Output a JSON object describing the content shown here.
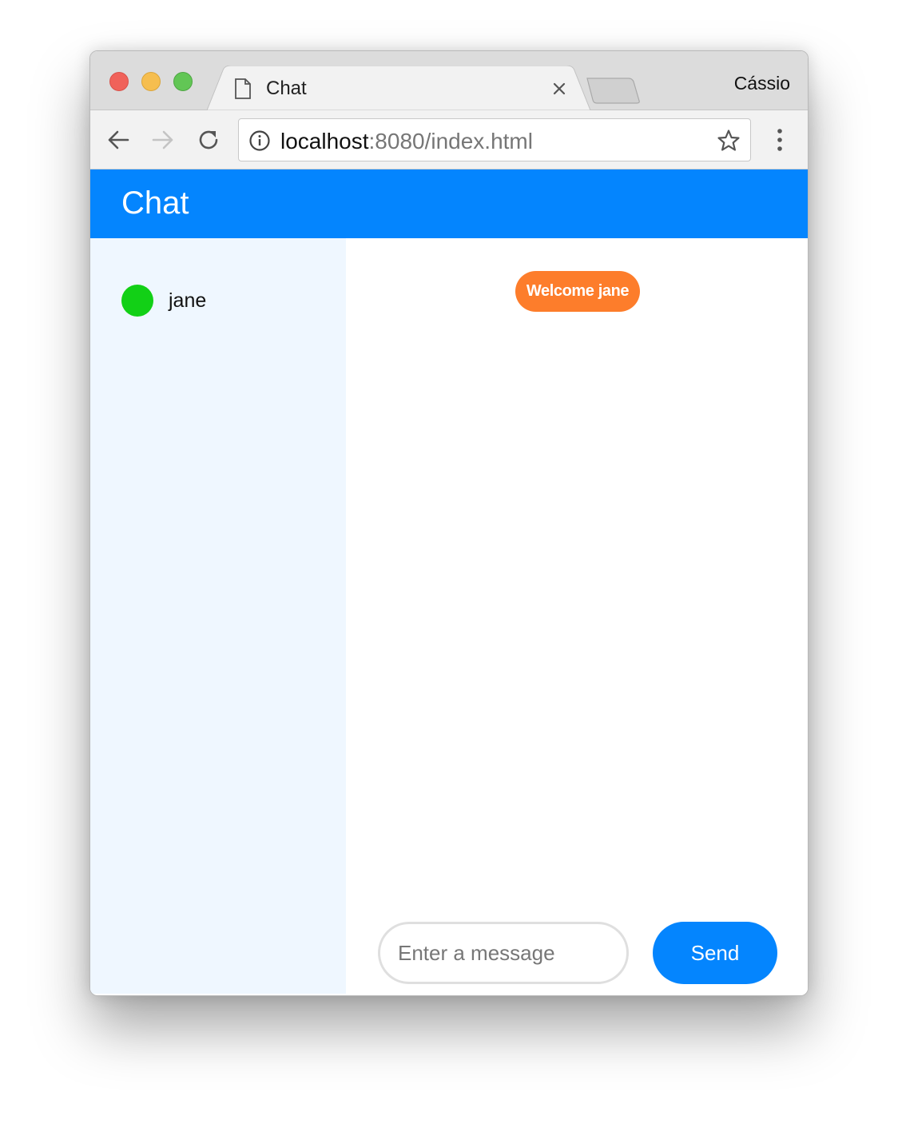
{
  "browser": {
    "tab_title": "Chat",
    "profile_name": "Cássio",
    "url_host": "localhost",
    "url_rest": ":8080/index.html"
  },
  "app": {
    "title": "Chat",
    "users": [
      {
        "name": "jane",
        "status_color": "#12d016"
      }
    ],
    "messages": [
      {
        "text": "Welcome jane",
        "color": "#fd7d2b"
      }
    ],
    "composer": {
      "placeholder": "Enter a message",
      "value": "",
      "send_label": "Send"
    }
  },
  "colors": {
    "accent": "#0485fe",
    "sidebar_bg": "#eff7ff"
  }
}
